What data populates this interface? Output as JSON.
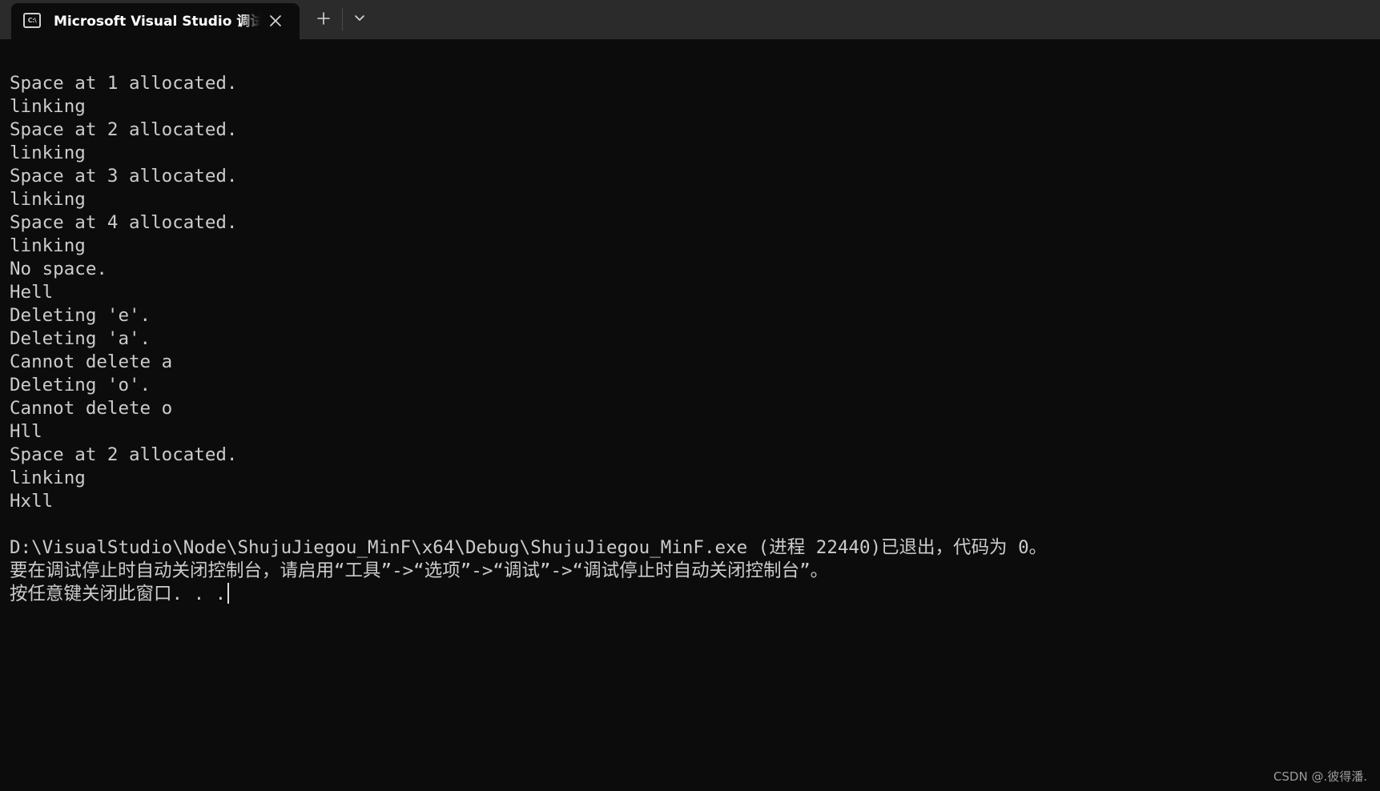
{
  "window": {
    "tab_icon_text": "C:\\",
    "tab_title": "Microsoft Visual Studio 调试控制台",
    "close_icon": "close-icon",
    "new_tab_icon": "plus-icon",
    "dropdown_icon": "chevron-down-icon"
  },
  "console": {
    "lines": [
      "Space at 1 allocated.",
      "linking",
      "Space at 2 allocated.",
      "linking",
      "Space at 3 allocated.",
      "linking",
      "Space at 4 allocated.",
      "linking",
      "No space.",
      "Hell",
      "Deleting 'e'.",
      "Deleting 'a'.",
      "Cannot delete a",
      "Deleting 'o'.",
      "Cannot delete o",
      "Hll",
      "Space at 2 allocated.",
      "linking",
      "Hxll",
      "",
      "D:\\VisualStudio\\Node\\ShujuJiegou_MinF\\x64\\Debug\\ShujuJiegou_MinF.exe (进程 22440)已退出，代码为 0。",
      "要在调试停止时自动关闭控制台，请启用“工具”->“选项”->“调试”->“调试停止时自动关闭控制台”。",
      "按任意键关闭此窗口. . ."
    ]
  },
  "watermark": "CSDN @.彼得潘.",
  "colors": {
    "background": "#0c0c0c",
    "titlebar": "#2b2b2b",
    "text": "#cccccc"
  }
}
